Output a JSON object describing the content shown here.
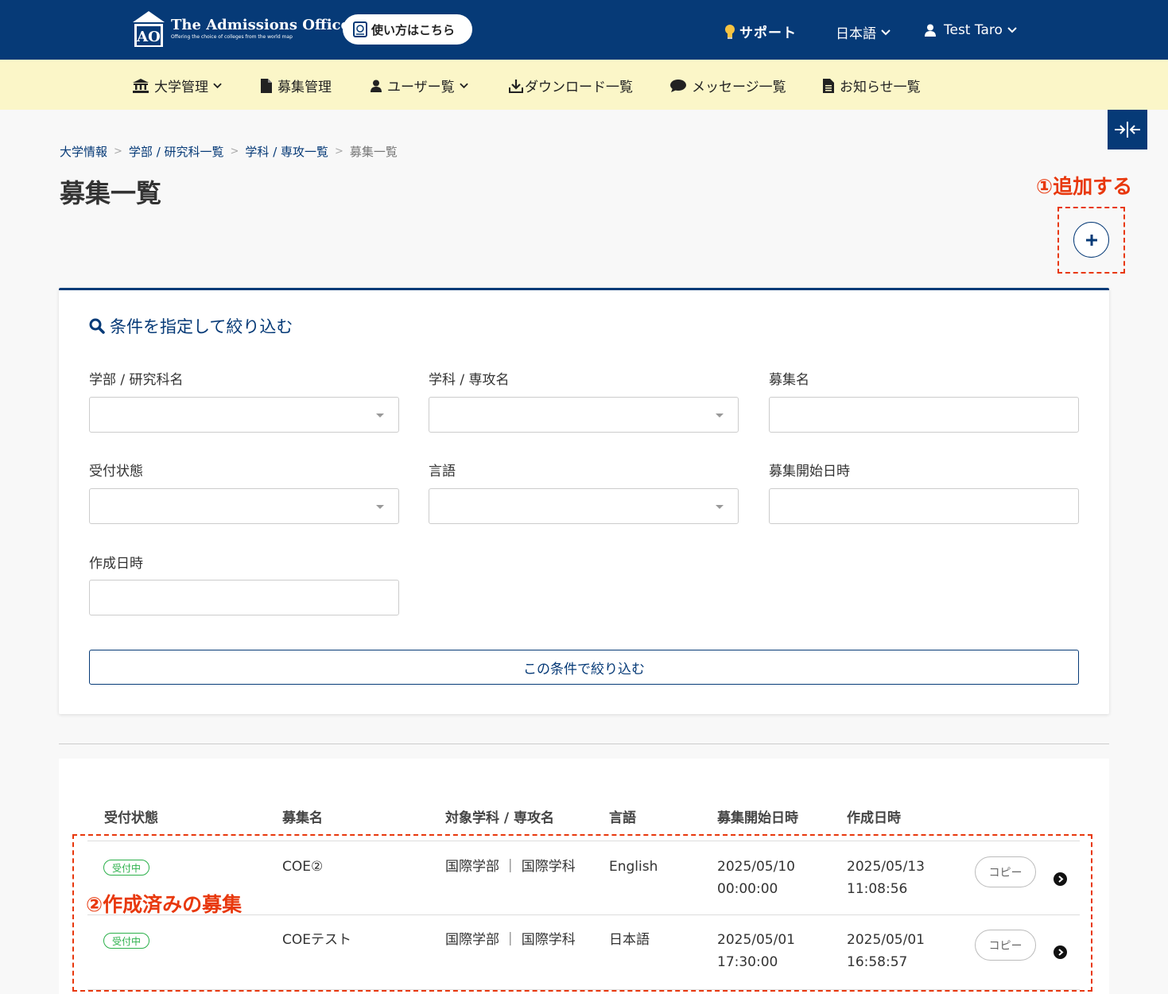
{
  "header": {
    "logo_title": "The Admissions Office",
    "logo_subtitle": "Offering the choice of colleges from the world map",
    "logo_mark_text": "AO",
    "howto_label": "使い方はこちら",
    "support_label": "サポート",
    "language_label": "日本語",
    "user_label": "Test Taro",
    "colors": {
      "primary": "#063a77",
      "nav_bg": "#fbf6c8",
      "annotation": "#e8380d",
      "badge": "#2bb04a"
    }
  },
  "nav": {
    "items": [
      {
        "label": "大学管理",
        "icon": "university-icon",
        "dropdown": true
      },
      {
        "label": "募集管理",
        "icon": "file-icon",
        "dropdown": false
      },
      {
        "label": "ユーザー覧",
        "icon": "user-icon",
        "dropdown": true
      },
      {
        "label": "ダウンロード一覧",
        "icon": "download-icon",
        "dropdown": false
      },
      {
        "label": "メッセージ一覧",
        "icon": "comment-icon",
        "dropdown": false
      },
      {
        "label": "お知らせ一覧",
        "icon": "document-icon",
        "dropdown": false
      }
    ]
  },
  "breadcrumb": [
    "大学情報",
    "学部 / 研究科一覧",
    "学科 / 専攻一覧",
    "募集一覧"
  ],
  "page": {
    "title": "募集一覧",
    "annotation_add": "①追加する",
    "annotation_existing": "②作成済みの募集"
  },
  "filter": {
    "title": "条件を指定して絞り込む",
    "fields": [
      {
        "label": "学部 / 研究科名",
        "type": "select",
        "value": ""
      },
      {
        "label": "学科 / 専攻名",
        "type": "select",
        "value": ""
      },
      {
        "label": "募集名",
        "type": "text",
        "value": ""
      },
      {
        "label": "受付状態",
        "type": "select",
        "value": ""
      },
      {
        "label": "言語",
        "type": "select",
        "value": ""
      },
      {
        "label": "募集開始日時",
        "type": "text",
        "value": ""
      },
      {
        "label": "作成日時",
        "type": "text",
        "value": ""
      }
    ],
    "submit_label": "この条件で絞り込む"
  },
  "table": {
    "columns": [
      "受付状態",
      "募集名",
      "対象学科 / 専攻名",
      "言語",
      "募集開始日時",
      "作成日時"
    ],
    "rows": [
      {
        "status": "受付中",
        "name": "COE②",
        "department": "国際学部 ｜ 国際学科",
        "language": "English",
        "start_date": "2025/05/10",
        "start_time": "00:00:00",
        "created_date": "2025/05/13",
        "created_time": "11:08:56",
        "copy_label": "コピー"
      },
      {
        "status": "受付中",
        "name": "COEテスト",
        "department": "国際学部 ｜ 国際学科",
        "language": "日本語",
        "start_date": "2025/05/01",
        "start_time": "17:30:00",
        "created_date": "2025/05/01",
        "created_time": "16:58:57",
        "copy_label": "コピー"
      }
    ]
  }
}
